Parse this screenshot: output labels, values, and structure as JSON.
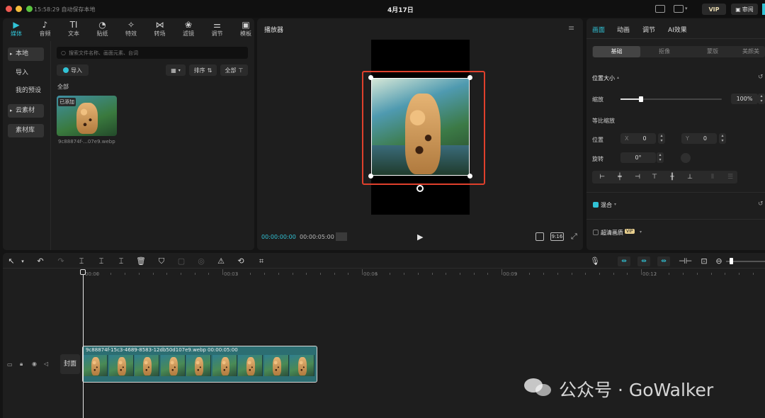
{
  "titlebar": {
    "status": "15:58:29 自动保存本地",
    "date": "4月17日",
    "vip": "VIP",
    "review": "审阅"
  },
  "media_tools": [
    {
      "label": "媒体",
      "icon": "media-icon",
      "glyph": "▶"
    },
    {
      "label": "音频",
      "icon": "audio-icon",
      "glyph": "♪"
    },
    {
      "label": "文本",
      "icon": "text-icon",
      "glyph": "TI"
    },
    {
      "label": "贴纸",
      "icon": "sticker-icon",
      "glyph": "◔"
    },
    {
      "label": "特效",
      "icon": "effects-icon",
      "glyph": "✧"
    },
    {
      "label": "转场",
      "icon": "transition-icon",
      "glyph": "⋈"
    },
    {
      "label": "滤镜",
      "icon": "filter-icon",
      "glyph": "❀"
    },
    {
      "label": "调节",
      "icon": "adjust-icon",
      "glyph": "⚌"
    },
    {
      "label": "模板",
      "icon": "template-icon",
      "glyph": "▣"
    }
  ],
  "sidebar": {
    "local": "本地",
    "import": "导入",
    "presets": "我的预设",
    "cloud": "云素材",
    "library": "素材库"
  },
  "media": {
    "search_placeholder": "搜索文件名称、画面元素、台词",
    "import_btn": "导入",
    "sort": "排序",
    "all_filter": "全部",
    "section": "全部",
    "thumb_badge": "已添加",
    "thumb_name": "9c88874f-...07e9.webp"
  },
  "player": {
    "title": "播放器",
    "time_current": "00:00:00:00",
    "time_total": "00:00:05:00",
    "ratio": "9:16"
  },
  "right_panel": {
    "tabs": [
      "画面",
      "动画",
      "调节",
      "AI效果"
    ],
    "subtabs": [
      "基础",
      "抠像",
      "蒙版",
      "美颜美"
    ],
    "pos_size": "位置大小",
    "scale_label": "缩放",
    "scale_value": "100%",
    "scale_fraction": 0.2,
    "uniform_scale": "等比缩放",
    "position_label": "位置",
    "x_label": "X",
    "x_value": "0",
    "y_label": "Y",
    "y_value": "0",
    "rotate_label": "旋转",
    "rotate_value": "0°",
    "blend": "混合",
    "hd": "超清画质",
    "hd_vip": "VIP"
  },
  "timeline": {
    "ruler": [
      "00:00",
      "00:03",
      "00:06",
      "00:09",
      "00:12"
    ],
    "clip_name": "9c88874f-15c3-4689-8583-12db50d107e9.webp",
    "clip_duration": "00:00:05:00",
    "cover": "封面"
  },
  "watermark": "公众号 · GoWalker",
  "colors": {
    "accent": "#31c3d6",
    "selection": "#e0402c",
    "clip_bg": "#2c6e72"
  }
}
